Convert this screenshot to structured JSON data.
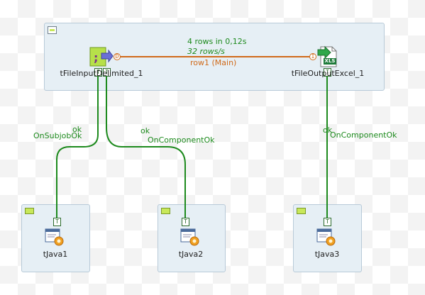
{
  "components": {
    "input": {
      "label": "tFileInputDelimited_1",
      "icon": "delimited-file-input-icon"
    },
    "output": {
      "label": "tFileOutputExcel_1",
      "icon": "excel-output-icon",
      "badge": "XLS"
    },
    "java1": {
      "label": "tJava1",
      "icon": "java-component-icon"
    },
    "java2": {
      "label": "tJava2",
      "icon": "java-component-icon"
    },
    "java3": {
      "label": "tJava3",
      "icon": "java-component-icon"
    }
  },
  "main_link": {
    "stats_rows": "4 rows in 0,12s",
    "stats_rate": "32 rows/s",
    "label": "row1 (Main)",
    "color": "#d06a1a"
  },
  "trigger_links": {
    "subjob_ok": {
      "status": "ok",
      "label": "OnSubjobOk"
    },
    "component_ok_1": {
      "status": "ok",
      "label": "OnComponentOk"
    },
    "component_ok_2": {
      "status": "ok",
      "label": "OnComponentOk"
    },
    "color": "#1d8a1d"
  },
  "ports": {
    "trigger": "T",
    "main_out": "D",
    "main_in": "I"
  }
}
